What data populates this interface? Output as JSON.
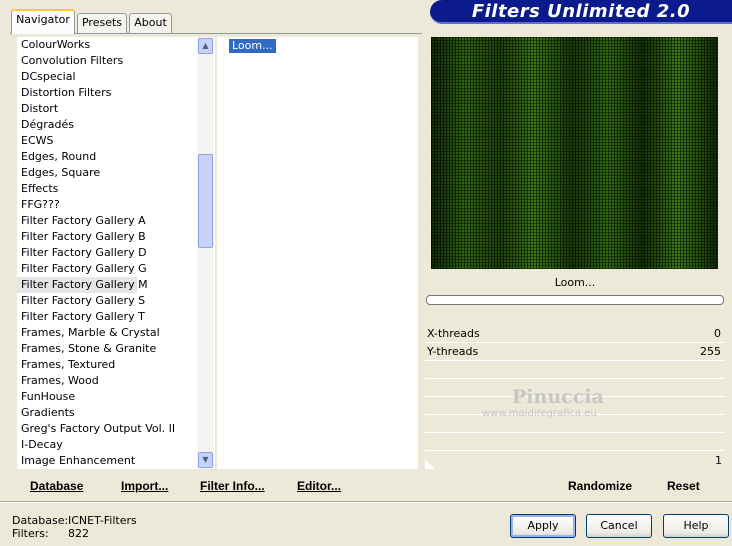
{
  "tabs": [
    {
      "label": "Navigator"
    },
    {
      "label": "Presets"
    },
    {
      "label": "About"
    }
  ],
  "banner": {
    "title": "Filters Unlimited 2.0"
  },
  "categories": [
    "ColourWorks",
    "Convolution Filters",
    "DCspecial",
    "Distortion Filters",
    "Distort",
    "Dégradés",
    "ECWS",
    "Edges, Round",
    "Edges, Square",
    "Effects",
    "FFG???",
    "Filter Factory Gallery A",
    "Filter Factory Gallery B",
    "Filter Factory Gallery D",
    "Filter Factory Gallery G",
    "Filter Factory Gallery M",
    "Filter Factory Gallery S",
    "Filter Factory Gallery T",
    "Frames, Marble & Crystal",
    "Frames, Stone & Granite",
    "Frames, Textured",
    "Frames, Wood",
    "FunHouse",
    "Gradients",
    "Greg's Factory Output Vol. II",
    "I-Decay",
    "Image Enhancement"
  ],
  "selected_category_index": 15,
  "filters": [
    "Loom..."
  ],
  "preview": {
    "filter_name": "Loom..."
  },
  "params": [
    {
      "name": "X-threads",
      "value": "0"
    },
    {
      "name": "Y-threads",
      "value": "255"
    }
  ],
  "slider_value": "1",
  "watermark": {
    "line1": "Pinuccia",
    "line2": "www.maidiregrafica.eu"
  },
  "toolbar": {
    "database": "Database",
    "import": "Import...",
    "filter_info": "Filter Info...",
    "editor": "Editor...",
    "randomize": "Randomize",
    "reset": "Reset"
  },
  "status": {
    "database_key": "Database:",
    "database_value": "ICNET-Filters",
    "filters_key": "Filters:",
    "filters_value": "822"
  },
  "dialog": {
    "apply": "Apply",
    "cancel": "Cancel",
    "help": "Help"
  },
  "colors": {
    "banner": "#0b1a8c",
    "selection": "#316ac5",
    "window": "#ece9d8"
  }
}
